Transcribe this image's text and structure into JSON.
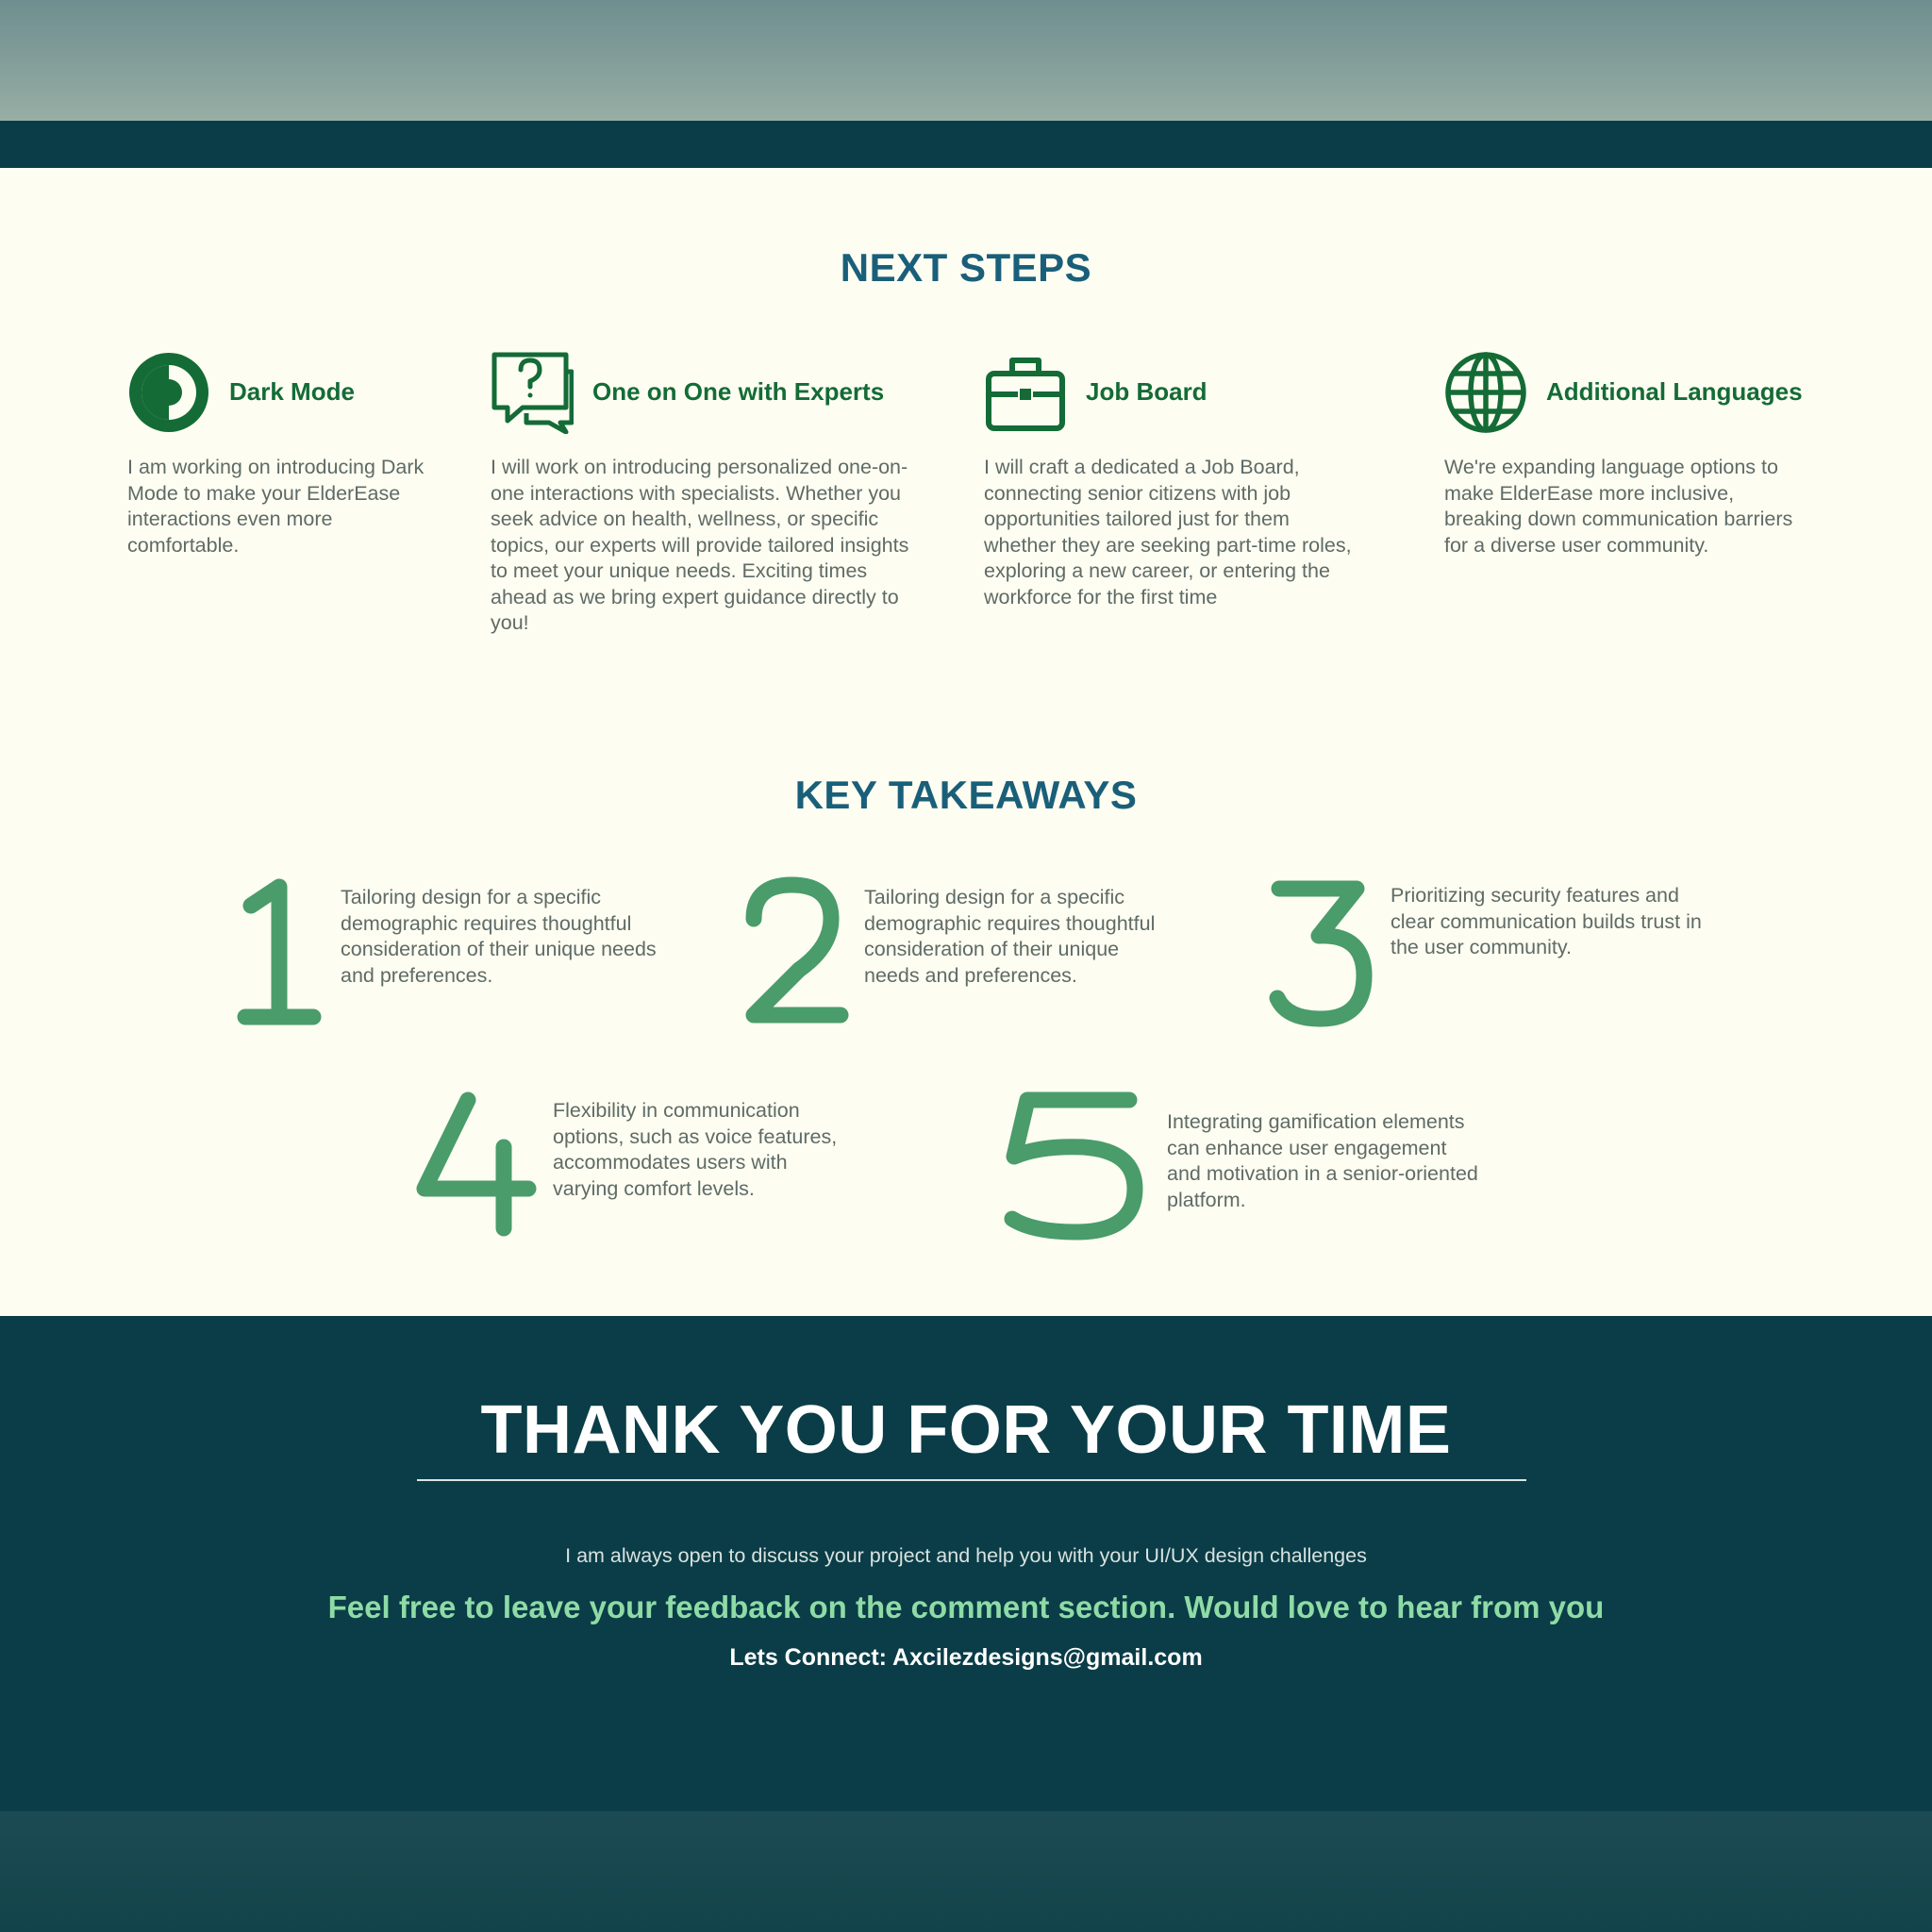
{
  "next_steps": {
    "title": "NEXT STEPS",
    "items": [
      {
        "icon": "dark-mode-icon",
        "title": "Dark Mode",
        "description": "I am working on introducing Dark Mode to make your ElderEase interactions even more comfortable."
      },
      {
        "icon": "question-chat-icon",
        "title": "One on One with Experts",
        "description": "I will work on introducing personalized one-on-one interactions with specialists. Whether you seek advice on health, wellness, or specific topics, our experts will provide tailored insights to meet your unique needs. Exciting times ahead as we bring expert guidance directly to you!"
      },
      {
        "icon": "briefcase-icon",
        "title": "Job Board",
        "description": "I will craft a dedicated  a Job Board, connecting senior citizens with job opportunities tailored just for them whether they are seeking part-time roles, exploring a new career, or entering the workforce for the first time"
      },
      {
        "icon": "globe-icon",
        "title": "Additional Languages",
        "description": "We're expanding language options to make ElderEase more inclusive, breaking down communication barriers for a diverse user community."
      }
    ]
  },
  "key_takeaways": {
    "title": "KEY TAKEAWAYS",
    "items": [
      {
        "number": "1",
        "text": "Tailoring design for a specific demographic requires thoughtful consideration of their unique needs and preferences."
      },
      {
        "number": "2",
        "text": "Tailoring design for a specific demographic requires thoughtful consideration of their unique needs and preferences."
      },
      {
        "number": "3",
        "text": "Prioritizing security features and clear communication builds trust in the user community."
      },
      {
        "number": "4",
        "text": "Flexibility in communication options, such as voice features, accommodates users with varying comfort levels."
      },
      {
        "number": "5",
        "text": "Integrating gamification elements can enhance user engagement and motivation in a senior-oriented platform."
      }
    ]
  },
  "footer": {
    "title": "THANK YOU FOR YOUR TIME",
    "line1": "I am always open to discuss your project and help you with your UI/UX design challenges",
    "line2": "Feel free to leave your feedback on the comment section. Would love to hear from you",
    "line3": "Lets Connect: Axcilezdesigns@gmail.com"
  },
  "colors": {
    "heading": "#1a5f7a",
    "accent_green": "#146b36",
    "number_green": "#4a9c6a",
    "dark_teal": "#0a3d47",
    "cream_bg": "#fdfdf1",
    "footer_highlight": "#8fdba6"
  }
}
